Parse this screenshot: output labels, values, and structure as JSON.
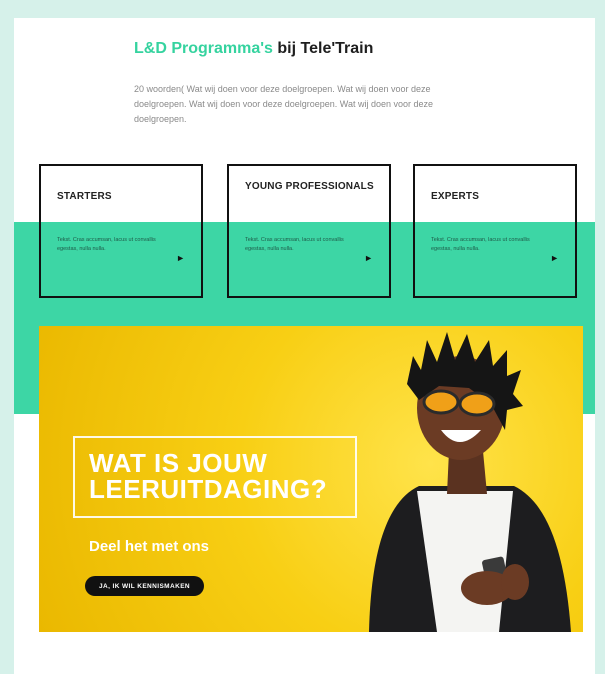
{
  "header": {
    "title_accent": "L&D Programma's",
    "title_rest": "bij Tele'Train",
    "intro": "20 woorden( Wat wij doen voor deze doelgroepen. Wat wij doen voor deze doelgroepen. Wat wij doen voor deze doelgroepen. Wat wij doen voor deze doelgroepen."
  },
  "programs": [
    {
      "title": "STARTERS",
      "desc": "Tekst. Cras accumsan, lacus ut convallis egestas, nulla nulla."
    },
    {
      "title": "YOUNG PROFESSIONALS",
      "desc": "Tekst. Cras accumsan, lacus ut convallis egestas, nulla nulla."
    },
    {
      "title": "EXPERTS",
      "desc": "Tekst. Cras accumsan, lacus ut convallis egestas, nulla nulla."
    }
  ],
  "hero": {
    "headline_line1": "WAT IS JOUW",
    "headline_line2": "LEERUITDAGING?",
    "subtitle": "Deel het met ons",
    "cta": "JA, IK WIL KENNISMAKEN"
  },
  "colors": {
    "accent": "#35d39f",
    "band": "#3dd6a5",
    "hero_yellow": "#f8cf14",
    "page_bg": "#d6f1ea"
  },
  "icons": {
    "card_arrow": "chevron-right-icon"
  }
}
